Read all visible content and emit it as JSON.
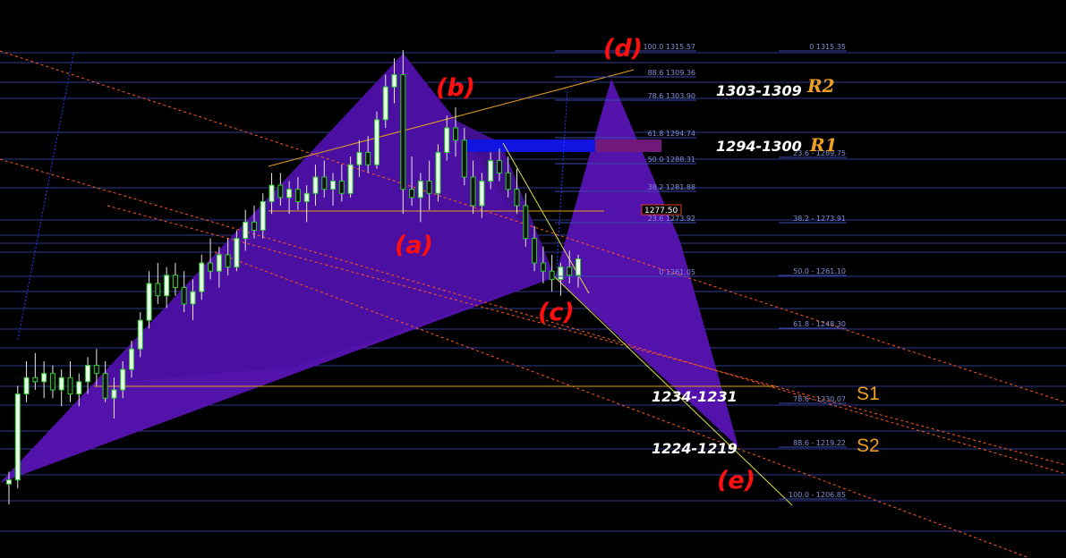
{
  "chart_data": {
    "type": "candlestick",
    "title": "",
    "fib_right": [
      {
        "pct": "0",
        "price": "1315.35"
      },
      {
        "pct": "23.6",
        "price": "1289.75"
      },
      {
        "pct": "38.2",
        "price": "1273.91"
      },
      {
        "pct": "50.0",
        "price": "1261.10"
      },
      {
        "pct": "61.8",
        "price": "1248.30"
      },
      {
        "pct": "78.6",
        "price": "1230.07"
      },
      {
        "pct": "88.6",
        "price": "1219.22"
      },
      {
        "pct": "100.0",
        "price": "1206.85"
      }
    ],
    "fib_mid": [
      {
        "pct": "100.0",
        "price": "1315.57"
      },
      {
        "pct": "88.6",
        "price": "1309.36"
      },
      {
        "pct": "78.6",
        "price": "1303.90"
      },
      {
        "pct": "61.8",
        "price": "1294.74"
      },
      {
        "pct": "50.0",
        "price": "1288.31"
      },
      {
        "pct": "38.2",
        "price": "1281.88"
      },
      {
        "pct": "23.6",
        "price": "1273.92"
      },
      {
        "pct": "0",
        "price": "1261.05"
      }
    ],
    "points": [
      {
        "label": "(a)",
        "name": "a"
      },
      {
        "label": "(b)",
        "name": "b"
      },
      {
        "label": "(c)",
        "name": "c"
      },
      {
        "label": "(d)",
        "name": "d"
      },
      {
        "label": "(e)",
        "name": "e"
      }
    ],
    "zones": [
      {
        "text": "1303-1309",
        "tag": "R2",
        "name": "r2"
      },
      {
        "text": "1294-1300",
        "tag": "R1",
        "name": "r1"
      },
      {
        "text": "1234-1231",
        "tag": "S1",
        "name": "s1"
      },
      {
        "text": "1224-1219",
        "tag": "S2",
        "name": "s2"
      }
    ],
    "current_price": "1277.50",
    "candles": [
      [
        1210,
        1213,
        1205,
        1211
      ],
      [
        1211,
        1234,
        1209,
        1232
      ],
      [
        1232,
        1240,
        1230,
        1236
      ],
      [
        1236,
        1242,
        1233,
        1235
      ],
      [
        1235,
        1240,
        1231,
        1237
      ],
      [
        1237,
        1239,
        1231,
        1233
      ],
      [
        1233,
        1238,
        1229,
        1236
      ],
      [
        1236,
        1240,
        1230,
        1232
      ],
      [
        1232,
        1237,
        1229,
        1235
      ],
      [
        1235,
        1241,
        1232,
        1239
      ],
      [
        1239,
        1243,
        1234,
        1237
      ],
      [
        1237,
        1240,
        1230,
        1231
      ],
      [
        1231,
        1236,
        1226,
        1233
      ],
      [
        1233,
        1240,
        1231,
        1238
      ],
      [
        1238,
        1245,
        1236,
        1243
      ],
      [
        1243,
        1252,
        1241,
        1250
      ],
      [
        1250,
        1262,
        1248,
        1259
      ],
      [
        1259,
        1264,
        1254,
        1256
      ],
      [
        1256,
        1263,
        1253,
        1261
      ],
      [
        1261,
        1264,
        1256,
        1258
      ],
      [
        1258,
        1262,
        1252,
        1254
      ],
      [
        1254,
        1260,
        1250,
        1257
      ],
      [
        1257,
        1266,
        1255,
        1264
      ],
      [
        1264,
        1270,
        1260,
        1262
      ],
      [
        1262,
        1268,
        1258,
        1266
      ],
      [
        1266,
        1270,
        1261,
        1263
      ],
      [
        1263,
        1272,
        1262,
        1270
      ],
      [
        1270,
        1277,
        1267,
        1274
      ],
      [
        1274,
        1278,
        1270,
        1272
      ],
      [
        1272,
        1281,
        1270,
        1279
      ],
      [
        1279,
        1286,
        1276,
        1283
      ],
      [
        1283,
        1286,
        1278,
        1280
      ],
      [
        1280,
        1284,
        1276,
        1282
      ],
      [
        1282,
        1285,
        1277,
        1279
      ],
      [
        1279,
        1283,
        1274,
        1281
      ],
      [
        1281,
        1288,
        1278,
        1285
      ],
      [
        1285,
        1289,
        1280,
        1282
      ],
      [
        1282,
        1286,
        1278,
        1284
      ],
      [
        1284,
        1288,
        1279,
        1281
      ],
      [
        1281,
        1290,
        1280,
        1288
      ],
      [
        1288,
        1294,
        1285,
        1291
      ],
      [
        1291,
        1295,
        1286,
        1288
      ],
      [
        1288,
        1301,
        1287,
        1299
      ],
      [
        1299,
        1310,
        1297,
        1307
      ],
      [
        1307,
        1314,
        1303,
        1310
      ],
      [
        1310,
        1316,
        1276,
        1282
      ],
      [
        1282,
        1290,
        1278,
        1280
      ],
      [
        1280,
        1286,
        1274,
        1284
      ],
      [
        1284,
        1289,
        1277,
        1281
      ],
      [
        1281,
        1293,
        1279,
        1291
      ],
      [
        1291,
        1300,
        1289,
        1297
      ],
      [
        1297,
        1302,
        1290,
        1294
      ],
      [
        1294,
        1297,
        1283,
        1285
      ],
      [
        1285,
        1289,
        1276,
        1278
      ],
      [
        1278,
        1286,
        1275,
        1284
      ],
      [
        1284,
        1291,
        1282,
        1289
      ],
      [
        1289,
        1292,
        1284,
        1286
      ],
      [
        1286,
        1290,
        1280,
        1282
      ],
      [
        1282,
        1287,
        1276,
        1278
      ],
      [
        1278,
        1281,
        1268,
        1270
      ],
      [
        1270,
        1273,
        1262,
        1264
      ],
      [
        1264,
        1268,
        1259,
        1262
      ],
      [
        1262,
        1266,
        1257,
        1260
      ],
      [
        1260,
        1264,
        1256,
        1263
      ],
      [
        1263,
        1267,
        1259,
        1261
      ],
      [
        1261,
        1266,
        1258,
        1265
      ]
    ]
  }
}
